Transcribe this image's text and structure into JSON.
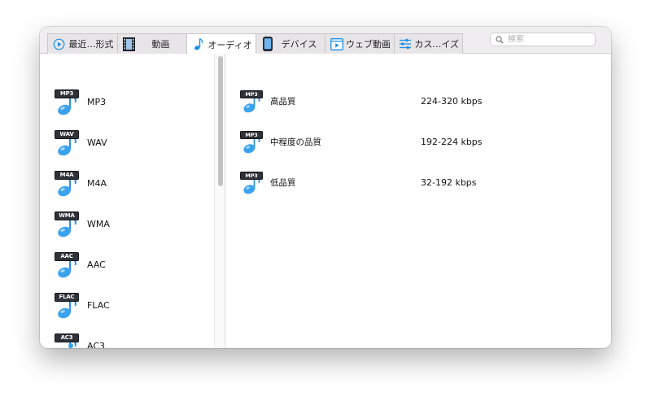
{
  "tabs": [
    {
      "id": "recent",
      "label": "最近…形式",
      "icon": "recent-icon",
      "active": false
    },
    {
      "id": "video",
      "label": "動画",
      "icon": "film-icon",
      "active": false
    },
    {
      "id": "audio",
      "label": "オーディオ",
      "icon": "music-note-icon",
      "active": true
    },
    {
      "id": "device",
      "label": "デバイス",
      "icon": "phone-icon",
      "active": false
    },
    {
      "id": "web",
      "label": "ウェブ動画",
      "icon": "web-video-icon",
      "active": false
    },
    {
      "id": "custom",
      "label": "カス…イズ",
      "icon": "sliders-icon",
      "active": false
    }
  ],
  "search": {
    "placeholder": "検索",
    "icon": "search-icon"
  },
  "formats": [
    {
      "badge": "MP3",
      "name": "MP3"
    },
    {
      "badge": "WAV",
      "name": "WAV"
    },
    {
      "badge": "M4A",
      "name": "M4A"
    },
    {
      "badge": "WMA",
      "name": "WMA"
    },
    {
      "badge": "AAC",
      "name": "AAC"
    },
    {
      "badge": "FLAC",
      "name": "FLAC"
    },
    {
      "badge": "AC3",
      "name": "AC3"
    }
  ],
  "presets": [
    {
      "badge": "MP3",
      "name": "高品質",
      "bitrate": "224-320 kbps"
    },
    {
      "badge": "MP3",
      "name": "中程度の品質",
      "bitrate": "192-224 kbps"
    },
    {
      "badge": "MP3",
      "name": "低品質",
      "bitrate": "32-192 kbps"
    }
  ],
  "colors": {
    "accent": "#1a90e8",
    "note": "#3aa3ee",
    "badge_bg": "#2f3238"
  }
}
